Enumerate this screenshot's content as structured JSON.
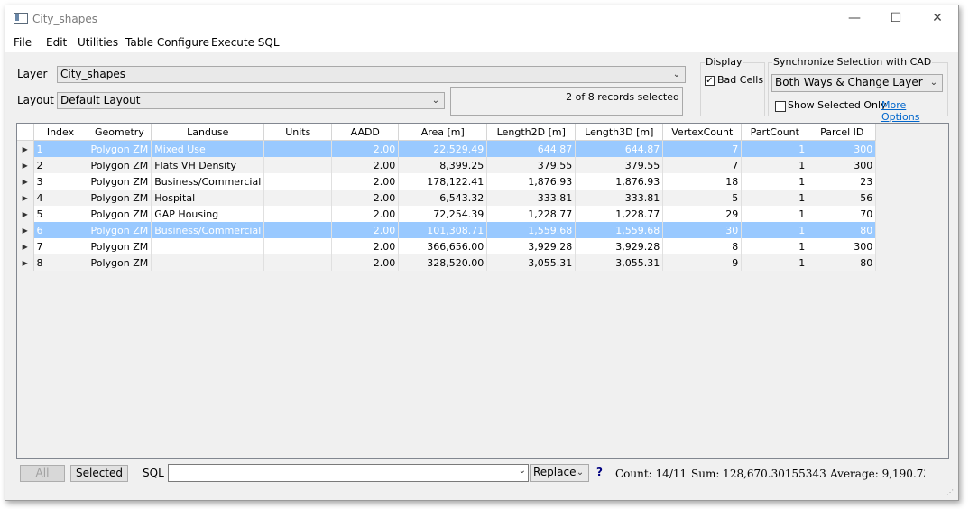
{
  "window": {
    "title": "City_shapes",
    "min_glyph": "—",
    "max_glyph": "☐",
    "close_glyph": "✕"
  },
  "menu": [
    "File",
    "Edit",
    "Utilities",
    "Table Configure",
    "Execute SQL"
  ],
  "layer": {
    "label": "Layer",
    "value": "City_shapes"
  },
  "layout": {
    "label": "Layout",
    "value": "Default Layout"
  },
  "status": {
    "text": "2 of 8 records selected"
  },
  "display": {
    "title": "Display",
    "bad_cells_label": "Bad Cells",
    "bad_cells_checked": true
  },
  "sync": {
    "title": "Synchronize Selection with CAD",
    "mode": "Both Ways & Change Layer",
    "show_selected_label": "Show Selected Only",
    "show_selected_checked": false,
    "more_options": "More Options"
  },
  "table": {
    "columns": [
      "Index",
      "Geometry",
      "Landuse",
      "Units",
      "AADD",
      "Area [m]",
      "Length2D [m]",
      "Length3D [m]",
      "VertexCount",
      "PartCount",
      "Parcel ID"
    ],
    "rows": [
      {
        "selected": true,
        "cells": [
          "1",
          "Polygon ZM",
          "Mixed Use",
          "",
          "2.00",
          "22,529.49",
          "644.87",
          "644.87",
          "7",
          "1",
          "300"
        ]
      },
      {
        "selected": false,
        "cells": [
          "2",
          "Polygon ZM",
          "Flats VH Density",
          "",
          "2.00",
          "8,399.25",
          "379.55",
          "379.55",
          "7",
          "1",
          "300"
        ]
      },
      {
        "selected": false,
        "cells": [
          "3",
          "Polygon ZM",
          "Business/Commercial",
          "",
          "2.00",
          "178,122.41",
          "1,876.93",
          "1,876.93",
          "18",
          "1",
          "23"
        ]
      },
      {
        "selected": false,
        "cells": [
          "4",
          "Polygon ZM",
          "Hospital",
          "",
          "2.00",
          "6,543.32",
          "333.81",
          "333.81",
          "5",
          "1",
          "56"
        ]
      },
      {
        "selected": false,
        "cells": [
          "5",
          "Polygon ZM",
          "GAP Housing",
          "",
          "2.00",
          "72,254.39",
          "1,228.77",
          "1,228.77",
          "29",
          "1",
          "70"
        ]
      },
      {
        "selected": true,
        "cells": [
          "6",
          "Polygon ZM",
          "Business/Commercial",
          "",
          "2.00",
          "101,308.71",
          "1,559.68",
          "1,559.68",
          "30",
          "1",
          "80"
        ]
      },
      {
        "selected": false,
        "cells": [
          "7",
          "Polygon ZM",
          "",
          "",
          "2.00",
          "366,656.00",
          "3,929.28",
          "3,929.28",
          "8",
          "1",
          "300"
        ]
      },
      {
        "selected": false,
        "cells": [
          "8",
          "Polygon ZM",
          "",
          "",
          "2.00",
          "328,520.00",
          "3,055.31",
          "3,055.31",
          "9",
          "1",
          "80"
        ]
      }
    ]
  },
  "bottom": {
    "all_label": "All",
    "selected_label": "Selected",
    "sql_label": "SQL",
    "sql_value": "",
    "replace_label": "Replace",
    "help": "?",
    "count": "Count:  14/11",
    "sum": "Sum:  128,670.30155343",
    "average": "Average:  9,190.7358"
  }
}
